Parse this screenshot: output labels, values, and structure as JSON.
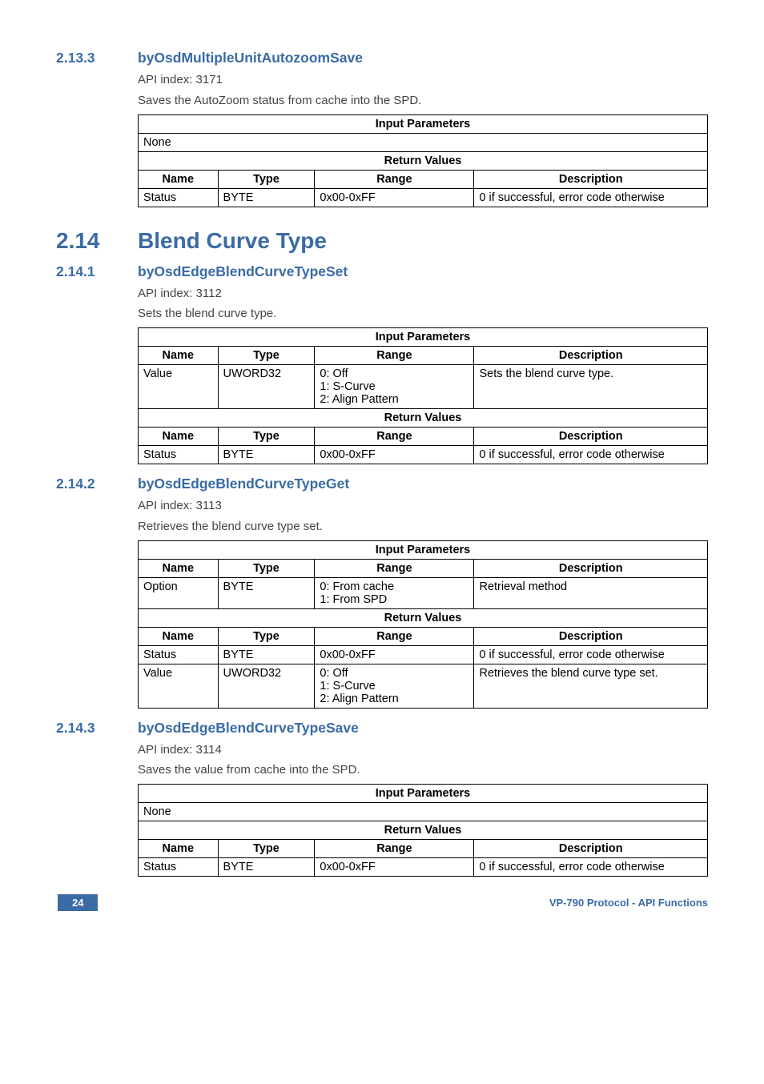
{
  "s2_13_3": {
    "num": "2.13.3",
    "title": "byOsdMultipleUnitAutozoomSave",
    "api_line": "API index: 3171",
    "desc": "Saves the AutoZoom status from cache into the SPD.",
    "input_hdr": "Input Parameters",
    "input_none": "None",
    "return_hdr": "Return Values",
    "cols": {
      "name": "Name",
      "type": "Type",
      "range": "Range",
      "desc": "Description"
    },
    "row": {
      "name": "Status",
      "type": "BYTE",
      "range": "0x00-0xFF",
      "desc": "0 if successful, error code otherwise"
    }
  },
  "s2_14": {
    "num": "2.14",
    "title": "Blend Curve Type"
  },
  "s2_14_1": {
    "num": "2.14.1",
    "title": "byOsdEdgeBlendCurveTypeSet",
    "api_line": "API index: 3112",
    "desc": "Sets the blend curve type.",
    "input_hdr": "Input Parameters",
    "cols": {
      "name": "Name",
      "type": "Type",
      "range": "Range",
      "desc": "Description"
    },
    "row1": {
      "name": "Value",
      "type": "UWORD32",
      "range_l1": "0: Off",
      "range_l2": "1: S-Curve",
      "range_l3": "2: Align Pattern",
      "desc": "Sets the blend curve type."
    },
    "return_hdr": "Return Values",
    "row2": {
      "name": "Status",
      "type": "BYTE",
      "range": "0x00-0xFF",
      "desc": "0 if successful, error code otherwise"
    }
  },
  "s2_14_2": {
    "num": "2.14.2",
    "title": "byOsdEdgeBlendCurveTypeGet",
    "api_line": "API index: 3113",
    "desc": "Retrieves the blend curve type set.",
    "input_hdr": "Input Parameters",
    "cols": {
      "name": "Name",
      "type": "Type",
      "range": "Range",
      "desc": "Description"
    },
    "row1": {
      "name": "Option",
      "type": "BYTE",
      "range_l1": "0: From cache",
      "range_l2": "1: From SPD",
      "desc": "Retrieval method"
    },
    "return_hdr": "Return Values",
    "row2": {
      "name": "Status",
      "type": "BYTE",
      "range": "0x00-0xFF",
      "desc": "0 if successful, error code otherwise"
    },
    "row3": {
      "name": "Value",
      "type": "UWORD32",
      "range_l1": "0: Off",
      "range_l2": "1: S-Curve",
      "range_l3": "2: Align Pattern",
      "desc": "Retrieves the blend curve type set."
    }
  },
  "s2_14_3": {
    "num": "2.14.3",
    "title": "byOsdEdgeBlendCurveTypeSave",
    "api_line": "API index: 3114",
    "desc": "Saves the value from cache into the SPD.",
    "input_hdr": "Input Parameters",
    "input_none": "None",
    "return_hdr": "Return Values",
    "cols": {
      "name": "Name",
      "type": "Type",
      "range": "Range",
      "desc": "Description"
    },
    "row": {
      "name": "Status",
      "type": "BYTE",
      "range": "0x00-0xFF",
      "desc": "0 if successful, error code otherwise"
    }
  },
  "footer": {
    "page": "24",
    "title": "VP-790 Protocol - API Functions"
  }
}
